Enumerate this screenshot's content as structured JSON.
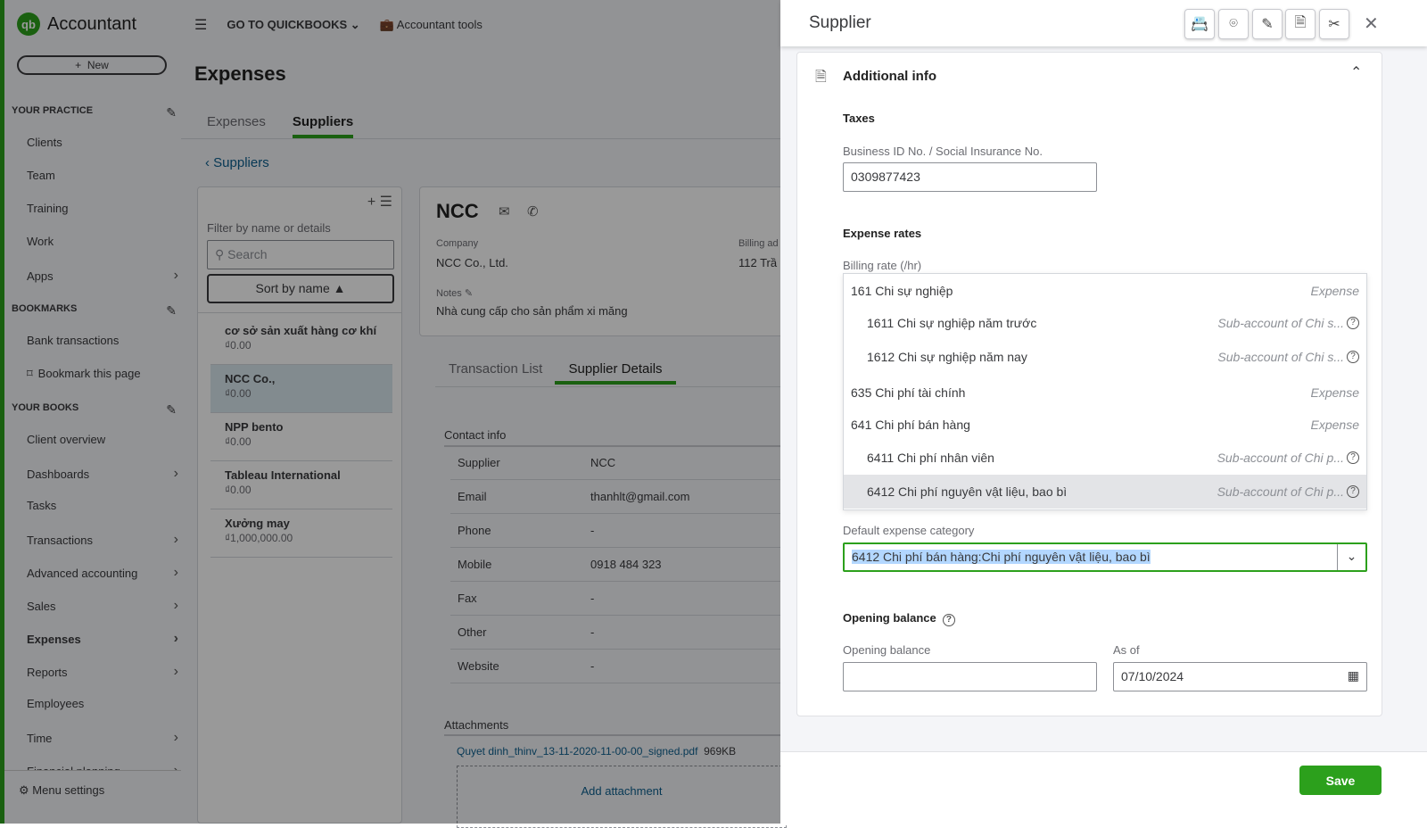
{
  "app": {
    "name": "Accountant",
    "logo": "qb",
    "new_label": "New",
    "go_to": "GO TO QUICKBOOKS",
    "accountant_tools": "Accountant tools"
  },
  "sidebar": {
    "sections": [
      {
        "title": "YOUR PRACTICE",
        "items": [
          {
            "label": "Clients"
          },
          {
            "label": "Team"
          },
          {
            "label": "Training"
          },
          {
            "label": "Work"
          },
          {
            "label": "Apps",
            "chevron": true
          }
        ]
      },
      {
        "title": "BOOKMARKS",
        "items": [
          {
            "label": "Bank transactions"
          },
          {
            "label": "Bookmark this page",
            "icon": "bookmark-icon"
          }
        ]
      },
      {
        "title": "YOUR BOOKS",
        "items": [
          {
            "label": "Client overview"
          },
          {
            "label": "Dashboards",
            "chevron": true
          },
          {
            "label": "Tasks"
          },
          {
            "label": "Transactions",
            "chevron": true
          },
          {
            "label": "Advanced accounting",
            "chevron": true
          },
          {
            "label": "Sales",
            "chevron": true
          },
          {
            "label": "Expenses",
            "chevron": true,
            "active": true
          },
          {
            "label": "Reports",
            "chevron": true
          },
          {
            "label": "Employees"
          },
          {
            "label": "Time",
            "chevron": true
          },
          {
            "label": "Financial planning",
            "chevron": true
          }
        ]
      }
    ],
    "menu_settings": "Menu settings"
  },
  "page": {
    "title": "Expenses",
    "tabs": [
      "Expenses",
      "Suppliers"
    ],
    "active_tab": "Suppliers",
    "back": "Suppliers"
  },
  "supplier_list": {
    "filter_label": "Filter by name or details",
    "search_placeholder": "Search",
    "sort_label": "Sort by name",
    "items": [
      {
        "name": "cơ sở sản xuất hàng cơ khí",
        "balance": "₫0.00"
      },
      {
        "name": "NCC Co.,",
        "balance": "₫0.00",
        "selected": true
      },
      {
        "name": "NPP bento",
        "balance": "₫0.00"
      },
      {
        "name": "Tableau International",
        "balance": "₫0.00"
      },
      {
        "name": "Xưởng may",
        "balance": "₫1,000,000.00"
      }
    ]
  },
  "supplier": {
    "name": "NCC",
    "company_label": "Company",
    "company": "NCC Co., Ltd.",
    "billing_label": "Billing ad",
    "billing": "112 Trầ",
    "notes_label": "Notes",
    "notes": "Nhà cung cấp cho sản phẩm xi măng",
    "tabs": [
      "Transaction List",
      "Supplier Details"
    ],
    "active_tab": "Supplier Details",
    "contact_title": "Contact info",
    "contact": [
      {
        "label": "Supplier",
        "value": "NCC"
      },
      {
        "label": "Email",
        "value": "thanhlt@gmail.com"
      },
      {
        "label": "Phone",
        "value": "-"
      },
      {
        "label": "Mobile",
        "value": "0918 484 323"
      },
      {
        "label": "Fax",
        "value": "-"
      },
      {
        "label": "Other",
        "value": "-"
      },
      {
        "label": "Website",
        "value": "-"
      }
    ],
    "attachments_title": "Attachments",
    "attachment": {
      "name": "Quyet dinh_thinv_13-11-2020-11-00-00_signed.pdf",
      "size": "969KB"
    },
    "add_attachment": "Add attachment"
  },
  "drawer": {
    "title": "Supplier",
    "section": "Additional info",
    "taxes": "Taxes",
    "business_id_label": "Business ID No. / Social Insurance No.",
    "business_id": "0309877423",
    "expense_rates": "Expense rates",
    "billing_rate_label": "Billing rate (/hr)",
    "options": [
      {
        "name": "161 Chi sự nghiệp",
        "type": "Expense"
      },
      {
        "name": "1611 Chi sự nghiệp năm trước",
        "type": "Sub-account of Chi s...",
        "sub": true
      },
      {
        "name": "1612 Chi sự nghiệp năm nay",
        "type": "Sub-account of Chi s...",
        "sub": true
      },
      {
        "name": "635 Chi phí tài chính",
        "type": "Expense"
      },
      {
        "name": "641 Chi phí bán hàng",
        "type": "Expense"
      },
      {
        "name": "6411 Chi phí nhân viên",
        "type": "Sub-account of Chi p...",
        "sub": true
      },
      {
        "name": "6412 Chi phí nguyên vật liệu, bao bì",
        "type": "Sub-account of Chi p...",
        "sub": true,
        "highlighted": true
      }
    ],
    "default_category_label": "Default expense category",
    "default_category": "6412 Chi phí bán hàng:Chi phí nguyên vật liệu, bao bì",
    "opening_balance_title": "Opening balance",
    "opening_balance_label": "Opening balance",
    "opening_balance": "",
    "as_of_label": "As of",
    "as_of": "07/10/2024",
    "save": "Save"
  },
  "colors": {
    "brand": "#2ca01c",
    "link": "#0d5f8e",
    "focus": "#2ca01c",
    "selection": "#b3d7ff"
  }
}
